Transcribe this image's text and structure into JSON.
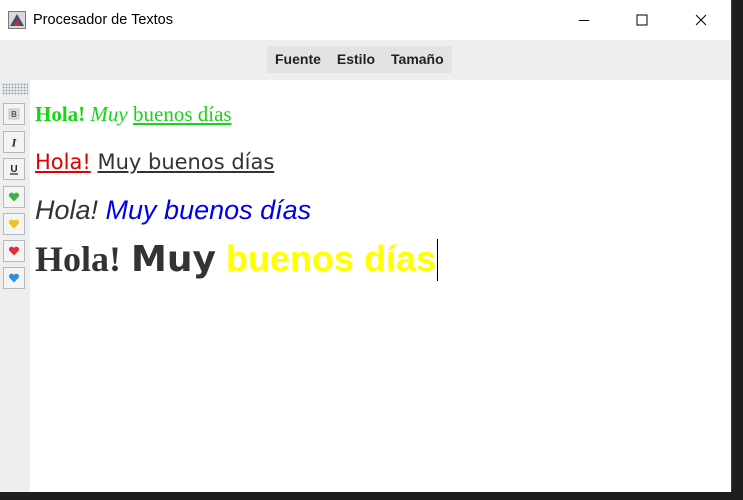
{
  "window": {
    "title": "Procesador de Textos",
    "controls": {
      "minimize": "─",
      "maximize": "☐",
      "close": "✕"
    }
  },
  "menu": {
    "items": [
      "Fuente",
      "Estilo",
      "Tamaño"
    ]
  },
  "toolbar": {
    "buttons": [
      {
        "name": "bold-button",
        "glyph": "B",
        "icon": "bold-icon"
      },
      {
        "name": "italic-button",
        "glyph": "I",
        "icon": "italic-icon"
      },
      {
        "name": "underline-button",
        "glyph": "U",
        "icon": "underline-icon"
      },
      {
        "name": "color-green-button",
        "icon": "green-heart-icon",
        "color": "#3cb43c"
      },
      {
        "name": "color-yellow-button",
        "icon": "yellow-heart-icon",
        "color": "#f2c21b"
      },
      {
        "name": "color-red-button",
        "icon": "red-heart-icon",
        "color": "#e0303a"
      },
      {
        "name": "color-blue-button",
        "icon": "blue-heart-icon",
        "color": "#2b8fe0"
      }
    ]
  },
  "document": {
    "line1": {
      "hola": "Hola!",
      "muy": "Muy",
      "buenos": "buenos días"
    },
    "line2": {
      "hola": "Hola!",
      "rest": "Muy buenos días"
    },
    "line3": {
      "hola": "Hola!",
      "rest": "Muy buenos días"
    },
    "line4": {
      "hola": "Hola!",
      "muy": "Muy",
      "buenos": "buenos días"
    }
  },
  "colors": {
    "green": "#18d418",
    "red": "#e00000",
    "blue": "#0000e6",
    "yellow": "#ffff00",
    "dark_text": "#333333"
  }
}
